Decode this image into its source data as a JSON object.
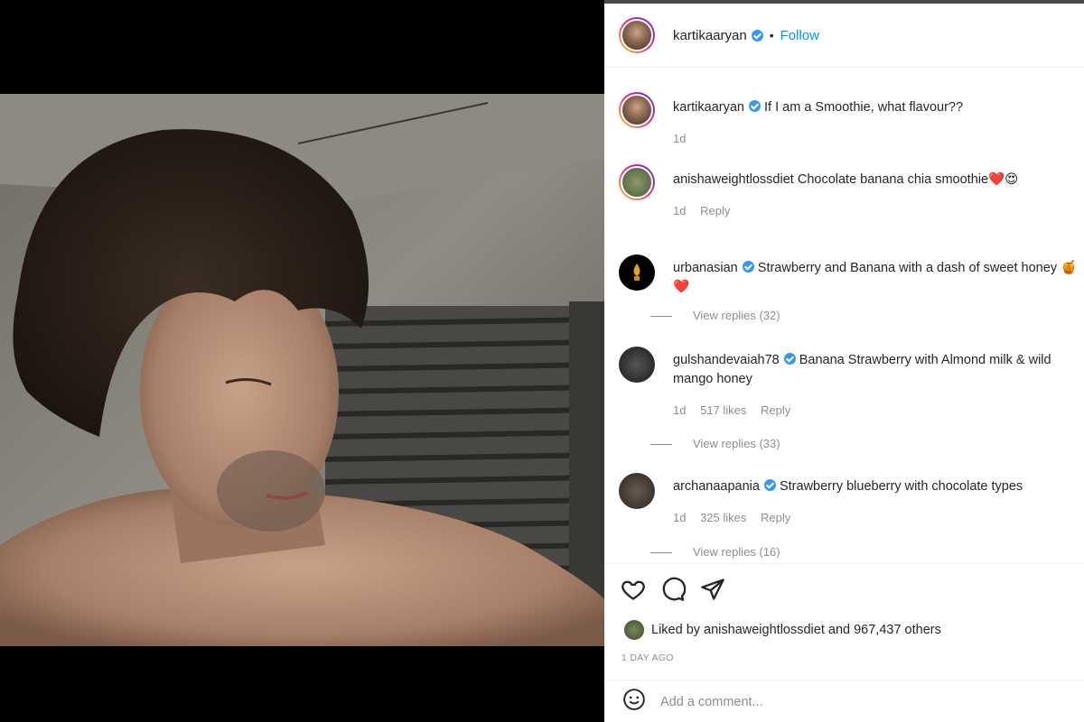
{
  "post": {
    "author": "kartikaaryan",
    "follow_label": "Follow",
    "separator": "•"
  },
  "comments": [
    {
      "user": "kartikaaryan",
      "text": "If I am a Smoothie, what flavour??",
      "time": "1d",
      "likes": "",
      "reply": "",
      "verified": true
    },
    {
      "user": "anishaweightlossdiet",
      "text": "Chocolate banana chia smoothie",
      "emoji": "❤️😍",
      "time": "1d",
      "likes": "",
      "reply": "Reply",
      "verified": false
    },
    {
      "user": "urbanasian",
      "text": "Strawberry and Banana with a dash of sweet honey",
      "emoji": "🍯❤️",
      "time": "",
      "likes": "",
      "reply": "",
      "view_replies": "View replies (32)",
      "verified": true
    },
    {
      "user": "gulshandevaiah78",
      "text": "Banana Strawberry with Almond milk & wild mango honey",
      "time": "1d",
      "likes": "517 likes",
      "reply": "Reply",
      "view_replies": "View replies (33)",
      "verified": true
    },
    {
      "user": "archanaapania",
      "text": "Strawberry blueberry with chocolate types",
      "time": "1d",
      "likes": "325 likes",
      "reply": "Reply",
      "view_replies": "View replies (16)",
      "verified": true
    }
  ],
  "actions": {
    "liked_by_prefix": "Liked by",
    "liked_by_user": "anishaweightlossdiet",
    "liked_by_suffix": "and 967,437 others",
    "time_ago": "1 DAY AGO",
    "comment_placeholder": "Add a comment..."
  },
  "icons": {
    "like": "heart-icon",
    "comment": "comment-icon",
    "share": "share-icon",
    "emoji": "emoji-icon",
    "verified": "verified-badge-icon"
  },
  "colors": {
    "link_blue": "#0095f6",
    "verified_blue": "#3897f0",
    "heart_red": "#e0245e"
  }
}
